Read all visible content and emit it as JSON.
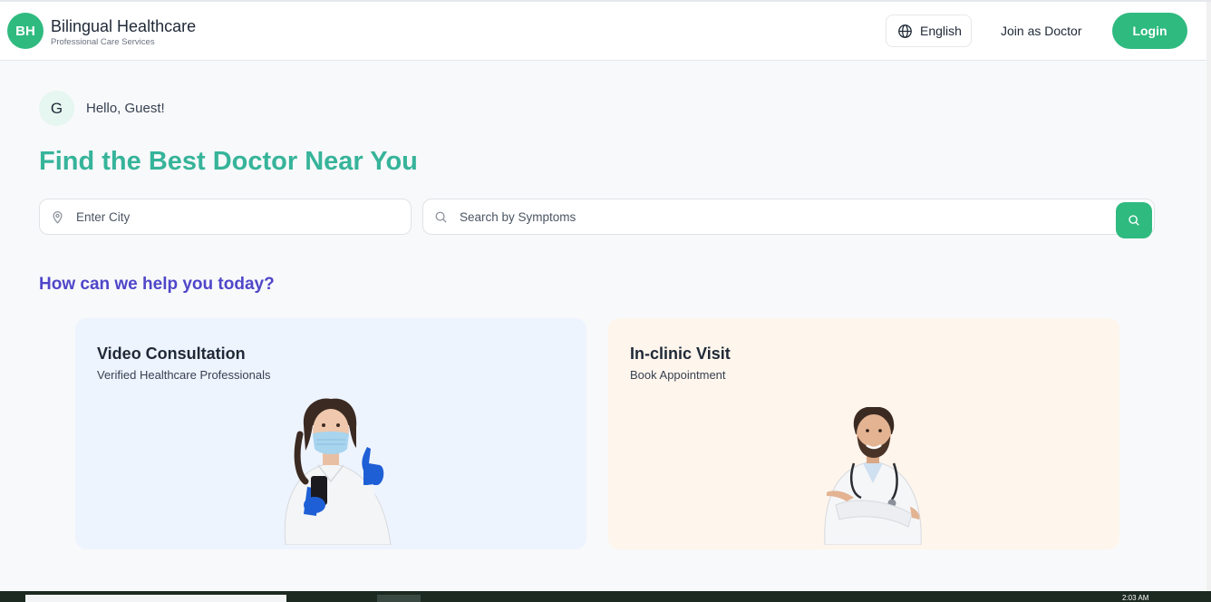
{
  "header": {
    "logo_initials": "BH",
    "brand_title": "Bilingual Healthcare",
    "brand_subtitle": "Professional Care Services",
    "language_label": "English",
    "join_label": "Join as Doctor",
    "login_label": "Login"
  },
  "greeting": {
    "avatar_initial": "G",
    "text": "Hello, Guest!"
  },
  "hero": {
    "title": "Find the Best Doctor Near You"
  },
  "search": {
    "city_placeholder": "Enter City",
    "symptom_placeholder": "Search by Symptoms"
  },
  "help": {
    "title": "How can we help you today?"
  },
  "cards": [
    {
      "title": "Video Consultation",
      "subtitle": "Verified Healthcare Professionals"
    },
    {
      "title": "In-clinic Visit",
      "subtitle": "Book Appointment"
    }
  ],
  "taskbar": {
    "clock": "2:03 AM"
  },
  "colors": {
    "accent": "#2fba7f",
    "hero_title": "#36b49a",
    "help_title": "#4f46c9",
    "video_card_bg": "#eef4fe",
    "clinic_card_bg": "#fef5ec"
  },
  "icons": [
    "globe-icon",
    "map-pin-icon",
    "search-icon"
  ]
}
